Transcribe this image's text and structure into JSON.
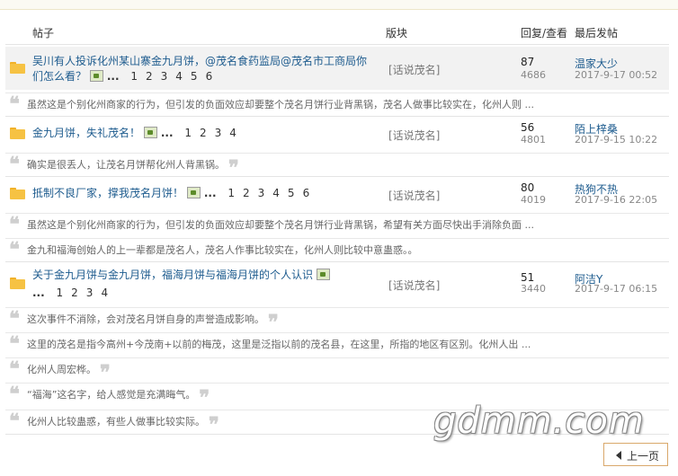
{
  "header": {
    "post": "帖子",
    "forum": "版块",
    "reply_view": "回复/查看",
    "last_post": "最后发帖"
  },
  "threads": [
    {
      "title_line1": "吴川有人投诉化州某山寨金九月饼，@茂名食药监局@茂名市工商局你",
      "title_line2": "们怎么看？",
      "dots": "...",
      "pages": [
        "1",
        "2",
        "3",
        "4",
        "5",
        "6"
      ],
      "forum": "[话说茂名]",
      "replies": "87",
      "views": "4686",
      "last_user": "温家大少",
      "last_date": "2017-9-17 00:52",
      "quotes": [
        "虽然这是个别化州商家的行为，但引发的负面效应却要整个茂名月饼行业背黑锅，茂名人做事比较实在，化州人则 ..."
      ]
    },
    {
      "title_line1": "金九月饼，失礼茂名！",
      "dots": "...",
      "pages": [
        "1",
        "2",
        "3",
        "4"
      ],
      "forum": "[话说茂名]",
      "replies": "56",
      "views": "4801",
      "last_user": "陌上梓桑",
      "last_date": "2017-9-15 10:22",
      "quotes": [
        "确实是很丢人，让茂名月饼帮化州人背黑锅。"
      ]
    },
    {
      "title_line1": "抵制不良厂家，撑我茂名月饼！",
      "dots": "...",
      "pages": [
        "1",
        "2",
        "3",
        "4",
        "5",
        "6"
      ],
      "forum": "[话说茂名]",
      "replies": "80",
      "views": "4019",
      "last_user": "热狗不热",
      "last_date": "2017-9-16 22:05",
      "quotes": [
        "虽然这是个别化州商家的行为，但引发的负面效应却要整个茂名月饼行业背黑锅，希望有关方面尽快出手消除负面 ...",
        "金九和福海创始人的上一辈都是茂名人，茂名人作事比较实在，化州人则比较中意蛊惑。。"
      ]
    },
    {
      "title_line1": "关于金九月饼与金九月饼，福海月饼与福海月饼的个人认识",
      "dots": "...",
      "pages": [
        "1",
        "2",
        "3",
        "4"
      ],
      "forum": "[话说茂名]",
      "replies": "51",
      "views": "3440",
      "last_user": "阿洁Y",
      "last_date": "2017-9-17 06:15",
      "quotes": [
        "这次事件不消除，会对茂名月饼自身的声誉造成影响。",
        "这里的茂名是指今高州+今茂南+以前的梅茂，这里是泛指以前的茂名县，在这里，所指的地区有区别。化州人出 ...",
        "化州人周宏桦。",
        "“福海”这名字，给人感觉是充满晦气。",
        "化州人比较蛊惑，有些人做事比较实际。"
      ]
    }
  ],
  "watermark": "gdmm.com",
  "prev_button": "上一页"
}
